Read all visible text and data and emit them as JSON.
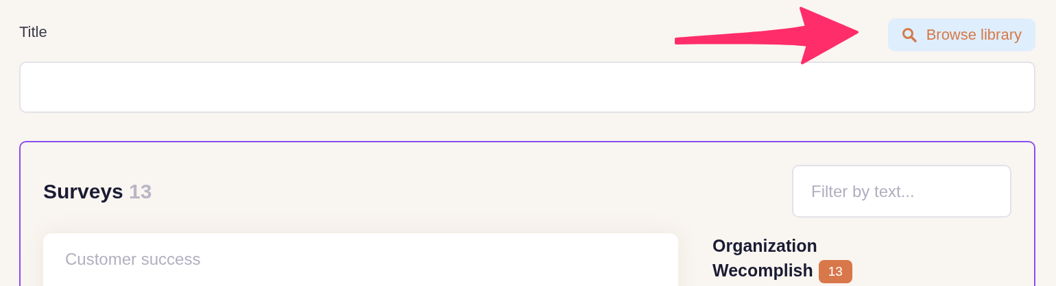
{
  "title_field": {
    "label": "Title"
  },
  "browse_button": {
    "label": "Browse library"
  },
  "surveys": {
    "heading": "Surveys",
    "count": "13",
    "filter": {
      "placeholder": "Filter by text..."
    },
    "cards": [
      {
        "category": "Customer success"
      }
    ],
    "organization": {
      "label": "Organization Wecomplish",
      "count": "13"
    }
  }
}
